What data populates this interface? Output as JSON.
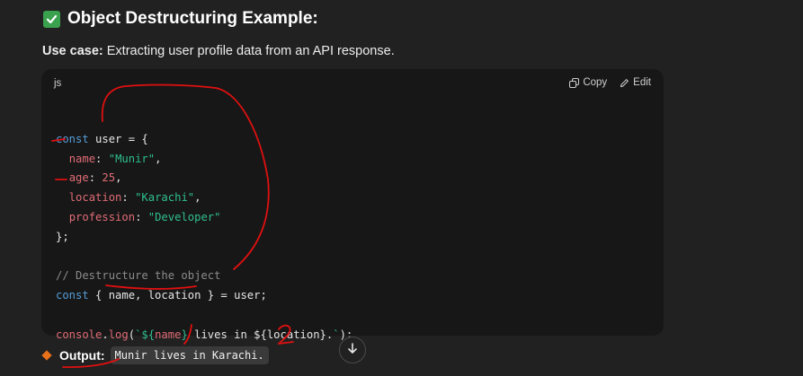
{
  "heading": {
    "title": "Object Destructuring Example:"
  },
  "usecase": {
    "label": "Use case:",
    "text": " Extracting user profile data from an API response."
  },
  "code_block": {
    "language": "js",
    "copy_label": "Copy",
    "edit_label": "Edit",
    "lines": [
      [],
      [
        {
          "t": "kw",
          "v": "const"
        },
        {
          "t": "pl",
          "v": " user = {"
        }
      ],
      [
        {
          "t": "pl",
          "v": "  "
        },
        {
          "t": "prop",
          "v": "name"
        },
        {
          "t": "pl",
          "v": ": "
        },
        {
          "t": "str",
          "v": "\"Munir\""
        },
        {
          "t": "pl",
          "v": ","
        }
      ],
      [
        {
          "t": "pl",
          "v": "  "
        },
        {
          "t": "prop",
          "v": "age"
        },
        {
          "t": "pl",
          "v": ": "
        },
        {
          "t": "num",
          "v": "25"
        },
        {
          "t": "pl",
          "v": ","
        }
      ],
      [
        {
          "t": "pl",
          "v": "  "
        },
        {
          "t": "prop",
          "v": "location"
        },
        {
          "t": "pl",
          "v": ": "
        },
        {
          "t": "str",
          "v": "\"Karachi\""
        },
        {
          "t": "pl",
          "v": ","
        }
      ],
      [
        {
          "t": "pl",
          "v": "  "
        },
        {
          "t": "prop",
          "v": "profession"
        },
        {
          "t": "pl",
          "v": ": "
        },
        {
          "t": "str",
          "v": "\"Developer\""
        }
      ],
      [
        {
          "t": "pl",
          "v": "};"
        }
      ],
      [],
      [
        {
          "t": "cmt",
          "v": "// Destructure the object"
        }
      ],
      [
        {
          "t": "kw",
          "v": "const"
        },
        {
          "t": "pl",
          "v": " { name, location } = user;"
        }
      ],
      [],
      [
        {
          "t": "fn",
          "v": "console"
        },
        {
          "t": "pl",
          "v": "."
        },
        {
          "t": "fn",
          "v": "log"
        },
        {
          "t": "pl",
          "v": "("
        },
        {
          "t": "str",
          "v": "`${"
        },
        {
          "t": "prop",
          "v": "name"
        },
        {
          "t": "str",
          "v": "}"
        },
        {
          "t": "pl",
          "v": " lives in ${location}."
        },
        {
          "t": "str",
          "v": "`"
        },
        {
          "t": "pl",
          "v": ");"
        }
      ]
    ]
  },
  "output": {
    "label": "Output:",
    "value": "Munir lives in Karachi."
  },
  "colors": {
    "background": "#212121",
    "code_bg": "#171717",
    "annotation": "#e01010",
    "check": "#3aa14f",
    "diamond": "#e8711a"
  }
}
